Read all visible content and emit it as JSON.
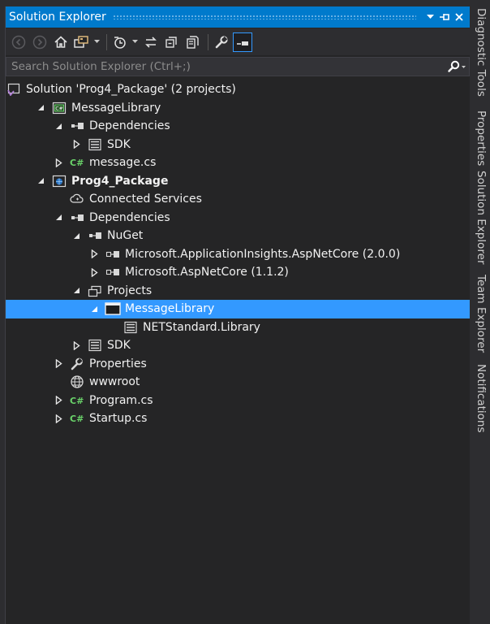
{
  "panel": {
    "title": "Solution Explorer",
    "controls": [
      "dropdown",
      "pin",
      "close"
    ]
  },
  "toolbar": {
    "buttons": [
      "back-icon",
      "forward-icon",
      "home-icon",
      "switch-views-icon",
      "pending-changes-icon",
      "sync-icon",
      "collapse-all-icon",
      "show-all-files-icon",
      "properties-wrench-icon",
      "preview-icon"
    ]
  },
  "search": {
    "placeholder": "Search Solution Explorer (Ctrl+;)"
  },
  "tree": [
    {
      "label": "Solution 'Prog4_Package' (2 projects)",
      "level": 0,
      "expander": "none",
      "icon": "solution-icon"
    },
    {
      "label": "MessageLibrary",
      "level": 1,
      "expander": "expanded",
      "icon": "csharp-project-icon"
    },
    {
      "label": "Dependencies",
      "level": 2,
      "expander": "expanded",
      "icon": "dependencies-icon"
    },
    {
      "label": "SDK",
      "level": 3,
      "expander": "collapsed",
      "icon": "sdk-icon"
    },
    {
      "label": "message.cs",
      "level": 2,
      "expander": "collapsed",
      "icon": "csharp-file-icon"
    },
    {
      "label": "Prog4_Package",
      "level": 1,
      "expander": "expanded",
      "icon": "web-project-icon",
      "bold": true
    },
    {
      "label": "Connected Services",
      "level": 2,
      "expander": "none",
      "icon": "connected-services-icon"
    },
    {
      "label": "Dependencies",
      "level": 2,
      "expander": "expanded",
      "icon": "dependencies-icon"
    },
    {
      "label": "NuGet",
      "level": 3,
      "expander": "expanded",
      "icon": "nuget-icon"
    },
    {
      "label": "Microsoft.ApplicationInsights.AspNetCore (2.0.0)",
      "level": 4,
      "expander": "collapsed",
      "icon": "package-icon"
    },
    {
      "label": "Microsoft.AspNetCore (1.1.2)",
      "level": 4,
      "expander": "collapsed",
      "icon": "package-icon"
    },
    {
      "label": "Projects",
      "level": 3,
      "expander": "expanded",
      "icon": "projects-icon"
    },
    {
      "label": "MessageLibrary",
      "level": 4,
      "expander": "expanded",
      "icon": "project-ref-icon",
      "selected": true
    },
    {
      "label": "NETStandard.Library",
      "level": 5,
      "expander": "none",
      "icon": "sdk-icon"
    },
    {
      "label": "SDK",
      "level": 3,
      "expander": "collapsed",
      "icon": "sdk-icon"
    },
    {
      "label": "Properties",
      "level": 2,
      "expander": "collapsed",
      "icon": "wrench-icon"
    },
    {
      "label": "wwwroot",
      "level": 2,
      "expander": "none",
      "icon": "globe-icon"
    },
    {
      "label": "Program.cs",
      "level": 2,
      "expander": "collapsed",
      "icon": "csharp-file-icon"
    },
    {
      "label": "Startup.cs",
      "level": 2,
      "expander": "collapsed",
      "icon": "csharp-file-icon"
    }
  ],
  "sidebar": {
    "tabs": [
      "Diagnostic Tools",
      "Properties",
      "Solution Explorer",
      "Team Explorer",
      "Notifications"
    ]
  },
  "colors": {
    "accent": "#007acc",
    "selection": "#3399ff",
    "background": "#252526",
    "csharp": "#6ad36a"
  }
}
